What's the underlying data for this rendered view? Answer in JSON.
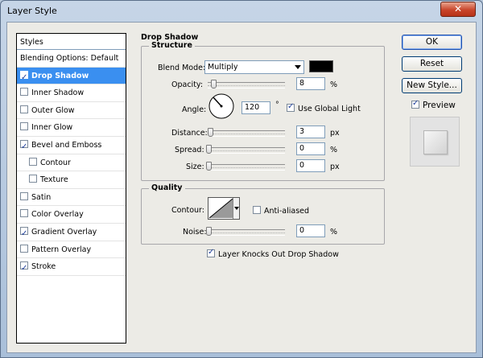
{
  "window": {
    "title": "Layer Style",
    "close_glyph": "✕"
  },
  "styles_list": {
    "header": "Styles",
    "items": [
      {
        "label": "Blending Options: Default",
        "checkbox": false,
        "checked": false,
        "selected": false,
        "sub": false
      },
      {
        "label": "Drop Shadow",
        "checkbox": true,
        "checked": true,
        "selected": true,
        "sub": false
      },
      {
        "label": "Inner Shadow",
        "checkbox": true,
        "checked": false,
        "selected": false,
        "sub": false
      },
      {
        "label": "Outer Glow",
        "checkbox": true,
        "checked": false,
        "selected": false,
        "sub": false
      },
      {
        "label": "Inner Glow",
        "checkbox": true,
        "checked": false,
        "selected": false,
        "sub": false
      },
      {
        "label": "Bevel and Emboss",
        "checkbox": true,
        "checked": true,
        "selected": false,
        "sub": false
      },
      {
        "label": "Contour",
        "checkbox": true,
        "checked": false,
        "selected": false,
        "sub": true
      },
      {
        "label": "Texture",
        "checkbox": true,
        "checked": false,
        "selected": false,
        "sub": true
      },
      {
        "label": "Satin",
        "checkbox": true,
        "checked": false,
        "selected": false,
        "sub": false
      },
      {
        "label": "Color Overlay",
        "checkbox": true,
        "checked": false,
        "selected": false,
        "sub": false
      },
      {
        "label": "Gradient Overlay",
        "checkbox": true,
        "checked": true,
        "selected": false,
        "sub": false
      },
      {
        "label": "Pattern Overlay",
        "checkbox": true,
        "checked": false,
        "selected": false,
        "sub": false
      },
      {
        "label": "Stroke",
        "checkbox": true,
        "checked": true,
        "selected": false,
        "sub": false
      }
    ]
  },
  "drop_shadow": {
    "title": "Drop Shadow",
    "structure": {
      "title": "Structure",
      "blend_mode_label": "Blend Mode:",
      "blend_mode_value": "Multiply",
      "shadow_color": "#000000",
      "opacity_label": "Opacity:",
      "opacity_value": "8",
      "opacity_unit": "%",
      "angle_label": "Angle:",
      "angle_value": "120",
      "angle_unit": "°",
      "global_light_label": "Use Global Light",
      "global_light_checked": true,
      "distance_label": "Distance:",
      "distance_value": "3",
      "distance_unit": "px",
      "spread_label": "Spread:",
      "spread_value": "0",
      "spread_unit": "%",
      "size_label": "Size:",
      "size_value": "0",
      "size_unit": "px"
    },
    "quality": {
      "title": "Quality",
      "contour_label": "Contour:",
      "anti_aliased_label": "Anti-aliased",
      "anti_aliased_checked": false,
      "noise_label": "Noise:",
      "noise_value": "0",
      "noise_unit": "%"
    },
    "knockout_label": "Layer Knocks Out Drop Shadow",
    "knockout_checked": true
  },
  "buttons": {
    "ok": "OK",
    "reset": "Reset",
    "new_style": "New Style...",
    "preview_label": "Preview",
    "preview_checked": true
  }
}
